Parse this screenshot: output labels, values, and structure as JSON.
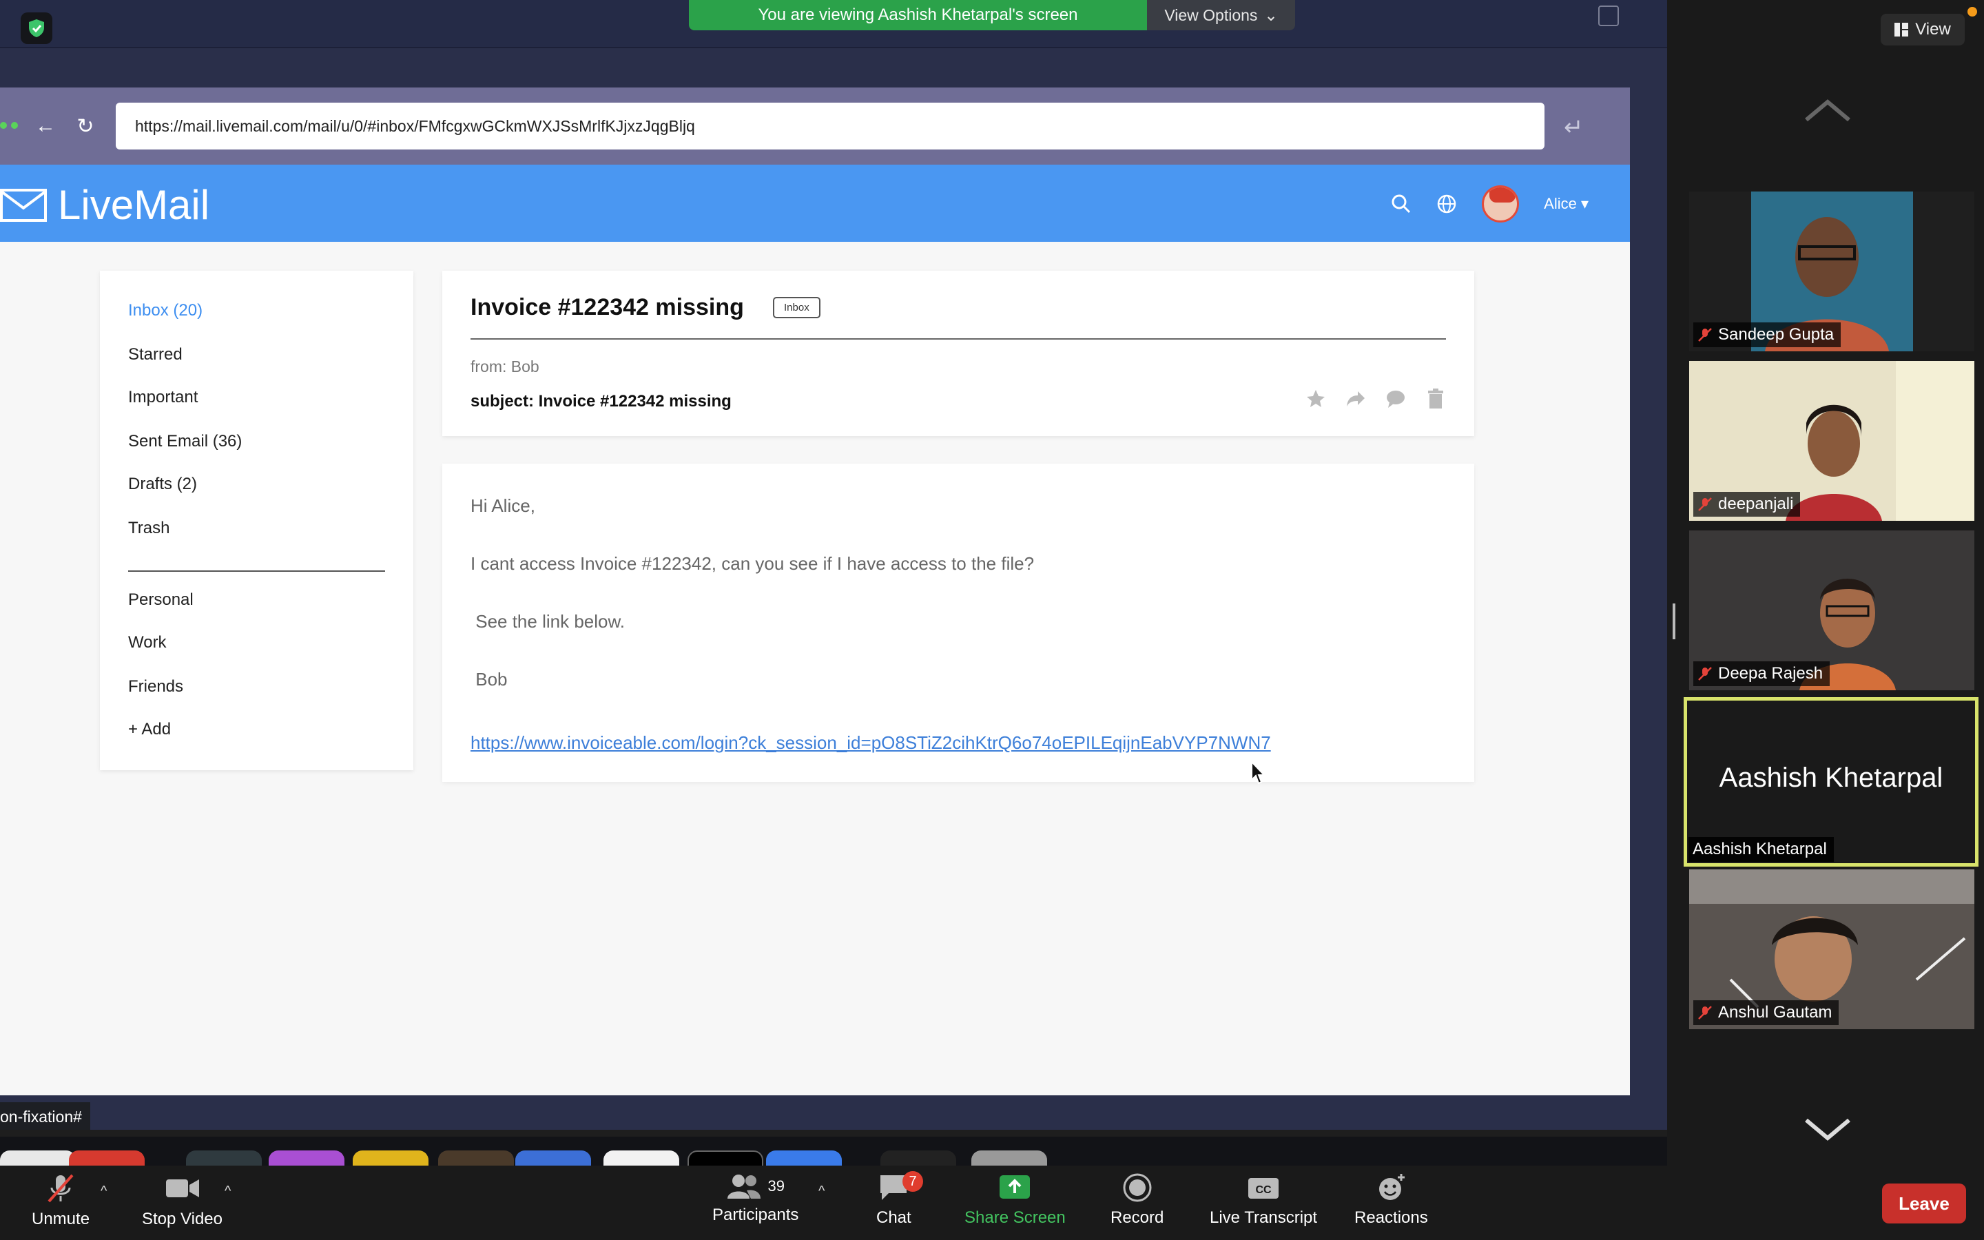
{
  "banner": {
    "viewing_text": "You are viewing Aashish Khetarpal's screen",
    "view_options_label": "View Options"
  },
  "browser": {
    "url": "https://mail.livemail.com/mail/u/0/#inbox/FMfcgxwGCkmWXJSsMrlfKJjxzJqgBljq"
  },
  "app": {
    "name": "LiveMail",
    "user_name": "Alice"
  },
  "sidebar": {
    "folders": [
      {
        "label": "Inbox (20)"
      },
      {
        "label": "Starred"
      },
      {
        "label": "Important"
      },
      {
        "label": "Sent Email (36)"
      },
      {
        "label": "Drafts (2)"
      },
      {
        "label": "Trash"
      }
    ],
    "labels": [
      {
        "label": "Personal"
      },
      {
        "label": "Work"
      },
      {
        "label": "Friends"
      },
      {
        "label": "+ Add"
      }
    ]
  },
  "email": {
    "title": "Invoice #122342 missing",
    "tag": "Inbox",
    "from": "from: Bob",
    "subject": "subject: Invoice #122342 missing",
    "body": {
      "greeting": "Hi Alice,",
      "line1": "I cant access Invoice #122342, can you see if I have access to the file?",
      "line2": " See the link below.",
      "signature": " Bob",
      "link": "https://www.invoiceable.com/login?ck_session_id=pO8STiZ2cihKtrQ6o74oEPILEqijnEabVYP7NWN7"
    }
  },
  "status_tip": "on-fixation#",
  "panel": {
    "view_label": "View",
    "participants": [
      {
        "name": "Sandeep Gupta"
      },
      {
        "name": "deepanjali"
      },
      {
        "name": "Deepa Rajesh"
      },
      {
        "name": "Aashish Khetarpal",
        "big_name": "Aashish Khetarpal"
      },
      {
        "name": "Anshul Gautam"
      }
    ]
  },
  "toolbar": {
    "unmute": "Unmute",
    "stop_video": "Stop Video",
    "participants": "Participants",
    "participants_count": "39",
    "chat": "Chat",
    "chat_badge": "7",
    "share_screen": "Share Screen",
    "record": "Record",
    "live_transcript": "Live Transcript",
    "reactions": "Reactions",
    "leave": "Leave"
  },
  "colors": {
    "appbar": "#4a97f2",
    "banner": "#2ba24a",
    "leave": "#c8302b",
    "link": "#3d7fd9",
    "active_speaker_border": "#d8e36b"
  }
}
